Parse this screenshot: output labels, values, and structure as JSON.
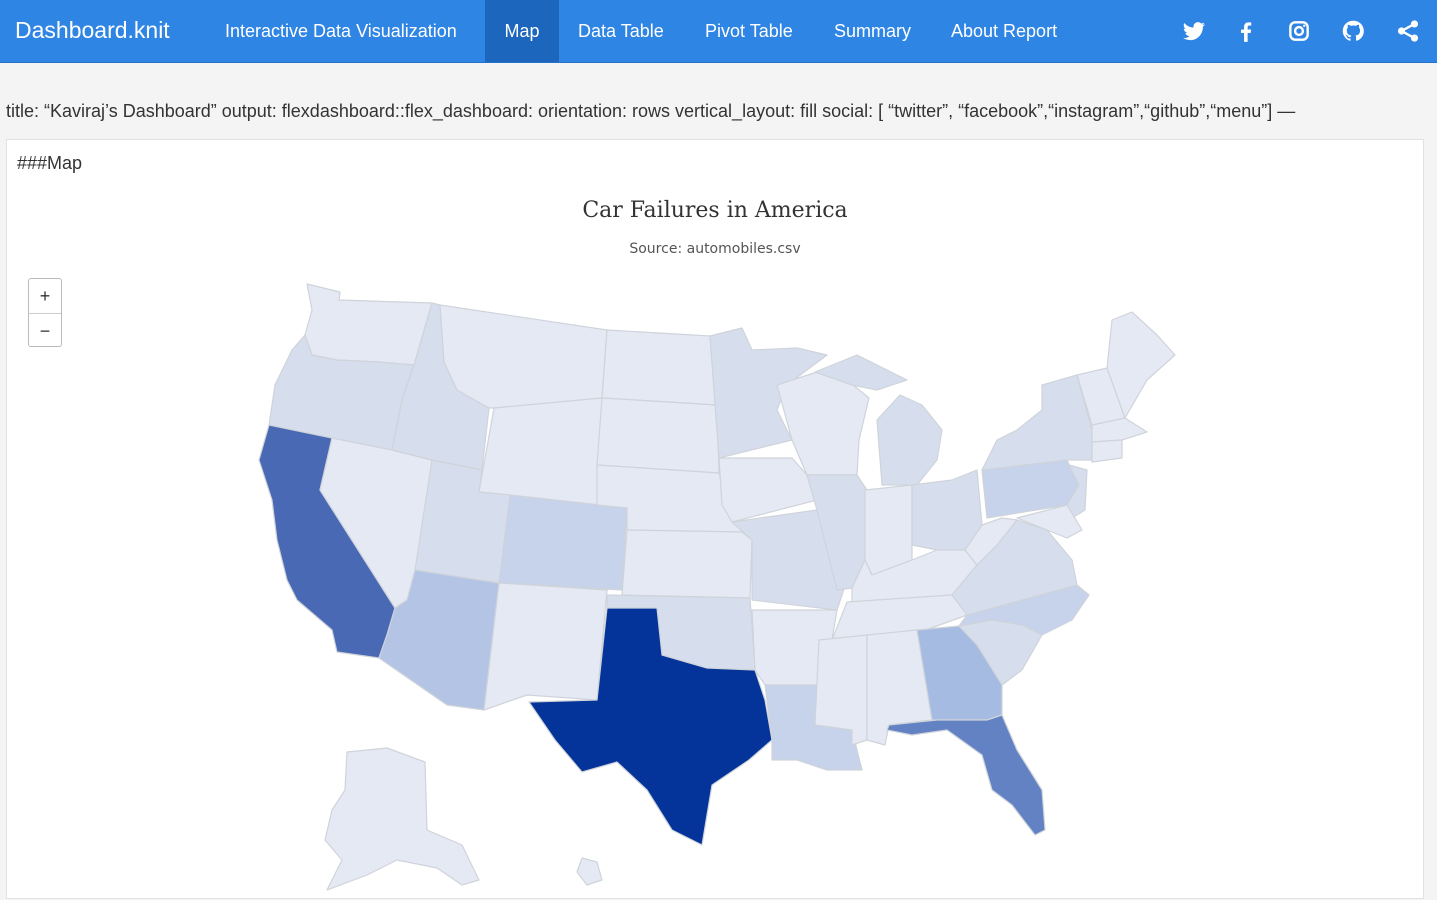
{
  "app": {
    "brand": "Dashboard.knit"
  },
  "nav": {
    "tabs": [
      {
        "label": "Interactive Data Visualization",
        "active": false
      },
      {
        "label": "Map",
        "active": true
      },
      {
        "label": "Data Table",
        "active": false
      },
      {
        "label": "Pivot Table",
        "active": false
      },
      {
        "label": "Summary",
        "active": false
      },
      {
        "label": "About Report",
        "active": false
      }
    ],
    "social_icons": [
      "twitter-icon",
      "facebook-icon",
      "instagram-icon",
      "github-icon",
      "share-icon"
    ]
  },
  "yaml_text": "title: “Kaviraj’s Dashboard” output: flexdashboard::flex_dashboard: orientation: rows vertical_layout: fill social: [ “twitter”, “facebook”,“instagram”,“github”,“menu”] —",
  "panel": {
    "heading": "###Map"
  },
  "map": {
    "title": "Car Failures in America",
    "subtitle": "Source: automobiles.csv",
    "zoom_in_label": "+",
    "zoom_out_label": "−",
    "colors": {
      "very_light": "#e4e9f4",
      "light": "#d6deee",
      "light_mid": "#c7d3ea",
      "mid": "#b3c4e5",
      "mid_dark": "#a6bbe1",
      "dark": "#6282c4",
      "darker": "#4a69b5",
      "darkest": "#04349a"
    }
  },
  "colors": {
    "navbar": "#2f85e4",
    "navbar_active": "#1c66bd"
  }
}
